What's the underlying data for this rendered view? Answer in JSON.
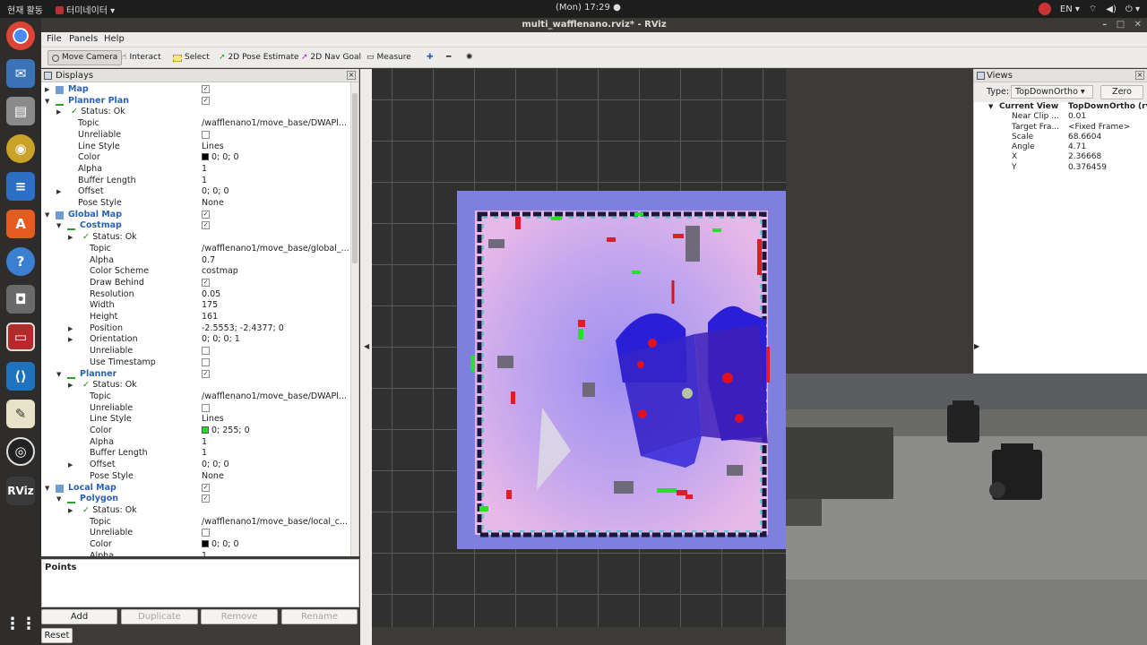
{
  "topbar": {
    "activities": "현재 활동",
    "app_name": "터미네이터",
    "clock": "(Mon) 17:29",
    "language": "EN"
  },
  "window": {
    "title": "multi_wafflenano.rviz* - RViz"
  },
  "menu": {
    "file": "File",
    "panels": "Panels",
    "help": "Help"
  },
  "toolbar": {
    "move_camera": "Move Camera",
    "interact": "Interact",
    "select": "Select",
    "pose_estimate": "2D Pose Estimate",
    "nav_goal": "2D Nav Goal",
    "measure": "Measure"
  },
  "displays": {
    "title": "Displays",
    "rows": [
      {
        "name": "Map",
        "value": "",
        "check": true,
        "section": true,
        "arrow": "▶",
        "indent": 0
      },
      {
        "name": "Planner Plan",
        "value": "",
        "check": true,
        "section": true,
        "arrow": "▼",
        "indent": 0
      },
      {
        "name": "Status: Ok",
        "value": "",
        "status": true,
        "arrow": "▶",
        "indent": 1
      },
      {
        "name": "Topic",
        "value": "/wafflenano1/move_base/DWAPl...",
        "indent": 1
      },
      {
        "name": "Unreliable",
        "value": "",
        "box": true,
        "indent": 1
      },
      {
        "name": "Line Style",
        "value": "Lines",
        "indent": 1
      },
      {
        "name": "Color",
        "value": "0; 0; 0",
        "swatch": "#000000",
        "indent": 1
      },
      {
        "name": "Alpha",
        "value": "1",
        "indent": 1
      },
      {
        "name": "Buffer Length",
        "value": "1",
        "indent": 1
      },
      {
        "name": "Offset",
        "value": "0; 0; 0",
        "arrow": "▶",
        "indent": 1
      },
      {
        "name": "Pose Style",
        "value": "None",
        "indent": 1
      },
      {
        "name": "Global Map",
        "value": "",
        "check": true,
        "section": true,
        "arrow": "▼",
        "indent": 0
      },
      {
        "name": "Costmap",
        "value": "",
        "check": true,
        "section": true,
        "arrow": "▼",
        "indent": 1
      },
      {
        "name": "Status: Ok",
        "value": "",
        "status": true,
        "arrow": "▶",
        "indent": 2
      },
      {
        "name": "Topic",
        "value": "/wafflenano1/move_base/global_...",
        "indent": 2
      },
      {
        "name": "Alpha",
        "value": "0.7",
        "indent": 2
      },
      {
        "name": "Color Scheme",
        "value": "costmap",
        "indent": 2
      },
      {
        "name": "Draw Behind",
        "value": "",
        "check": true,
        "indent": 2
      },
      {
        "name": "Resolution",
        "value": "0.05",
        "indent": 2
      },
      {
        "name": "Width",
        "value": "175",
        "indent": 2
      },
      {
        "name": "Height",
        "value": "161",
        "indent": 2
      },
      {
        "name": "Position",
        "value": "-2.5553; -2.4377; 0",
        "arrow": "▶",
        "indent": 2
      },
      {
        "name": "Orientation",
        "value": "0; 0; 0; 1",
        "arrow": "▶",
        "indent": 2
      },
      {
        "name": "Unreliable",
        "value": "",
        "box": true,
        "indent": 2
      },
      {
        "name": "Use Timestamp",
        "value": "",
        "box": true,
        "indent": 2
      },
      {
        "name": "Planner",
        "value": "",
        "check": true,
        "section": true,
        "arrow": "▼",
        "indent": 1
      },
      {
        "name": "Status: Ok",
        "value": "",
        "status": true,
        "arrow": "▶",
        "indent": 2
      },
      {
        "name": "Topic",
        "value": "/wafflenano1/move_base/DWAPl...",
        "indent": 2
      },
      {
        "name": "Unreliable",
        "value": "",
        "box": true,
        "indent": 2
      },
      {
        "name": "Line Style",
        "value": "Lines",
        "indent": 2
      },
      {
        "name": "Color",
        "value": "0; 255; 0",
        "swatch": "#22dd22",
        "indent": 2
      },
      {
        "name": "Alpha",
        "value": "1",
        "indent": 2
      },
      {
        "name": "Buffer Length",
        "value": "1",
        "indent": 2
      },
      {
        "name": "Offset",
        "value": "0; 0; 0",
        "arrow": "▶",
        "indent": 2
      },
      {
        "name": "Pose Style",
        "value": "None",
        "indent": 2
      },
      {
        "name": "Local Map",
        "value": "",
        "check": true,
        "section": true,
        "arrow": "▼",
        "indent": 0
      },
      {
        "name": "Polygon",
        "value": "",
        "check": true,
        "section": true,
        "arrow": "▼",
        "indent": 1
      },
      {
        "name": "Status: Ok",
        "value": "",
        "status": true,
        "arrow": "▶",
        "indent": 2
      },
      {
        "name": "Topic",
        "value": "/wafflenano1/move_base/local_c...",
        "indent": 2
      },
      {
        "name": "Unreliable",
        "value": "",
        "box": true,
        "indent": 2
      },
      {
        "name": "Color",
        "value": "0; 0; 0",
        "swatch": "#000000",
        "indent": 2
      },
      {
        "name": "Alpha",
        "value": "1",
        "indent": 2
      }
    ]
  },
  "points_label": "Points",
  "buttons": {
    "add": "Add",
    "duplicate": "Duplicate",
    "remove": "Remove",
    "rename": "Rename",
    "reset": "Reset"
  },
  "views": {
    "title": "Views",
    "type_label": "Type:",
    "type_value": "TopDownOrtho",
    "zero": "Zero",
    "current_view": "Current View",
    "current_view_value": "TopDownOrtho (rv",
    "props": [
      {
        "name": "Near Clip ...",
        "value": "0.01"
      },
      {
        "name": "Target Fra...",
        "value": "<Fixed Frame>"
      },
      {
        "name": "Scale",
        "value": "68.6604"
      },
      {
        "name": "Angle",
        "value": "4.71"
      },
      {
        "name": "X",
        "value": "2.36668"
      },
      {
        "name": "Y",
        "value": "0.376459"
      }
    ]
  },
  "colors": {
    "accent": "#2a62b6",
    "costmap_blue": "#2a1fd6",
    "costmap_red": "#e01020"
  }
}
